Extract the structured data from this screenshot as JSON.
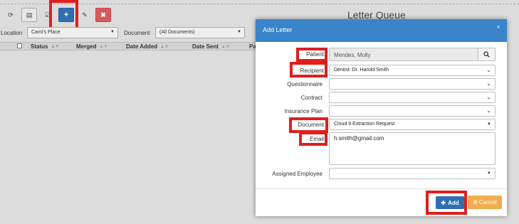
{
  "queue": {
    "title": "Letter Queue",
    "toolbar": {
      "refresh_icon": "refresh-icon",
      "list_icon": "list-icon",
      "check_icon": "check-icon",
      "add_label": "+",
      "edit_icon": "edit-icon",
      "delete_label": "✖"
    },
    "filters": {
      "location_label": "Location",
      "location_value": "Cami's Place",
      "document_label": "Document",
      "document_value": "(All Documents)"
    },
    "columns": [
      "Status",
      "Merged",
      "Date Added",
      "Date Sent",
      "Pa"
    ]
  },
  "modal": {
    "title": "Add Letter",
    "close": "×",
    "fields": {
      "patient_label": "Patient",
      "patient_value": "Mendes, Molly",
      "recipient_label": "Recipient",
      "recipient_value": "Dentist: Dr. Harold Smith",
      "questionnaire_label": "Questionnaire",
      "contract_label": "Contract",
      "insurance_label": "Insurance Plan",
      "document_label": "Document",
      "document_value": "Cloud 9 Extraction Request",
      "email_label": "Email",
      "email_value": "h.smith@gmail.com",
      "employee_label": "Assigned Employee"
    },
    "buttons": {
      "add_label": "Add",
      "add_icon": "plus-icon",
      "cancel_label": "Cancel",
      "cancel_icon": "ban-icon"
    }
  },
  "colors": {
    "primary": "#2f6fb3",
    "header": "#3a84c9",
    "warning": "#f0ad4e",
    "danger": "#d75a5a",
    "highlight": "#e01e1e"
  }
}
